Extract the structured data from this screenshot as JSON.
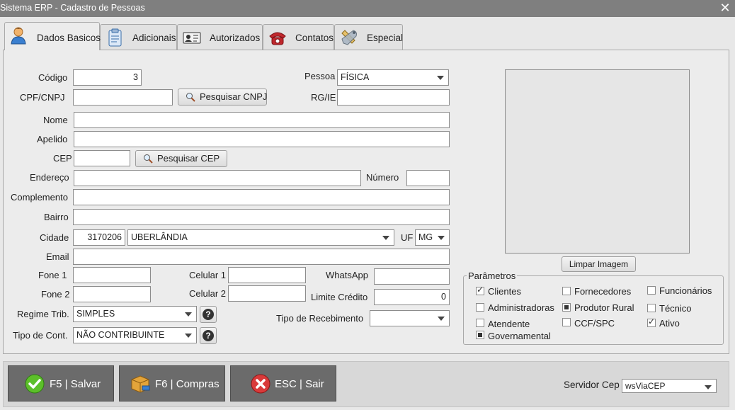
{
  "window": {
    "title": "Sistema ERP - Cadastro de Pessoas"
  },
  "tabs": [
    {
      "label": "Dados Basicos",
      "icon": "person-icon",
      "active": true
    },
    {
      "label": "Adicionais",
      "icon": "clipboard-icon"
    },
    {
      "label": "Autorizados",
      "icon": "id-card-icon"
    },
    {
      "label": "Contatos",
      "icon": "telephone-icon"
    },
    {
      "label": "Especial",
      "icon": "tools-icon"
    }
  ],
  "form": {
    "codigo": {
      "label": "Código",
      "value": "3"
    },
    "pessoa": {
      "label": "Pessoa",
      "value": "FÍSICA"
    },
    "cpf": {
      "label": "CPF/CNPJ",
      "value": ""
    },
    "pesquisar_cnpj": "Pesquisar CNPJ",
    "rg": {
      "label": "RG/IE",
      "value": ""
    },
    "nome": {
      "label": "Nome",
      "value": ""
    },
    "apelido": {
      "label": "Apelido",
      "value": ""
    },
    "cep": {
      "label": "CEP",
      "value": ""
    },
    "pesquisar_cep": "Pesquisar CEP",
    "endereco": {
      "label": "Endereço",
      "value": ""
    },
    "numero": {
      "label": "Número",
      "value": ""
    },
    "complemento": {
      "label": "Complemento",
      "value": ""
    },
    "bairro": {
      "label": "Bairro",
      "value": ""
    },
    "cidade": {
      "label": "Cidade",
      "code": "3170206",
      "name": "UBERLÂNDIA"
    },
    "uf": {
      "label": "UF",
      "value": "MG"
    },
    "email": {
      "label": "Email",
      "value": ""
    },
    "fone1": {
      "label": "Fone 1",
      "value": ""
    },
    "celular1": {
      "label": "Celular 1",
      "value": ""
    },
    "whatsapp": {
      "label": "WhatsApp",
      "value": ""
    },
    "fone2": {
      "label": "Fone 2",
      "value": ""
    },
    "celular2": {
      "label": "Celular 2",
      "value": ""
    },
    "limite": {
      "label": "Limite Crédito",
      "value": "0"
    },
    "regime": {
      "label": "Regime Trib.",
      "value": "SIMPLES"
    },
    "tipo_recebimento": {
      "label": "Tipo de Recebimento",
      "value": ""
    },
    "tipo_cont": {
      "label": "Tipo de Cont.",
      "value": "NÃO CONTRIBUINTE"
    },
    "help_glyph": "?"
  },
  "image": {
    "clear_label": "Limpar Imagem"
  },
  "parametros": {
    "legend": "Parâmetros",
    "items": [
      {
        "label": "Clientes",
        "state": "checked"
      },
      {
        "label": "Fornecedores",
        "state": "unchecked"
      },
      {
        "label": "Funcionários",
        "state": "unchecked"
      },
      {
        "label": "Administradoras",
        "state": "unchecked"
      },
      {
        "label": "Produtor Rural",
        "state": "indeterminate"
      },
      {
        "label": "Técnico",
        "state": "unchecked"
      },
      {
        "label": "Atendente",
        "state": "unchecked"
      },
      {
        "label": "CCF/SPC",
        "state": "unchecked"
      },
      {
        "label": "Ativo",
        "state": "checked"
      },
      {
        "label": "Governamental",
        "state": "indeterminate"
      }
    ]
  },
  "footer": {
    "salvar": "F5 | Salvar",
    "compras": "F6 | Compras",
    "sair": "ESC | Sair",
    "servidor_label": "Servidor Cep",
    "servidor_value": "wsViaCEP"
  },
  "colors": {
    "title_bar": "#7f7f7f",
    "footer_buttons": "#6b6b6b"
  }
}
